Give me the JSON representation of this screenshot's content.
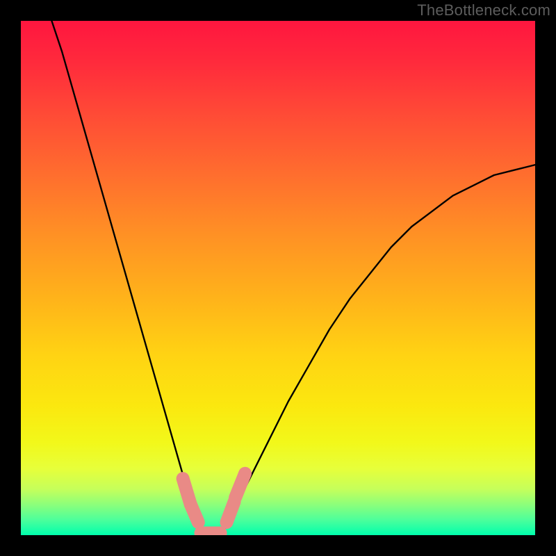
{
  "watermark": "TheBottleneck.com",
  "chart_data": {
    "type": "line",
    "title": "",
    "xlabel": "",
    "ylabel": "",
    "xlim": [
      0,
      100
    ],
    "ylim": [
      0,
      100
    ],
    "grid": false,
    "legend": false,
    "curve": {
      "comment": "V-shaped bottleneck curve; y is bottleneck percent (0 at trough)",
      "x": [
        6,
        8,
        10,
        12,
        14,
        16,
        18,
        20,
        22,
        24,
        26,
        28,
        30,
        32,
        34,
        35,
        37,
        39,
        41,
        44,
        48,
        52,
        56,
        60,
        64,
        68,
        72,
        76,
        80,
        84,
        88,
        92,
        96,
        100
      ],
      "y": [
        100,
        94,
        87,
        80,
        73,
        66,
        59,
        52,
        45,
        38,
        31,
        24,
        17,
        10,
        4,
        0,
        0,
        0,
        4,
        10,
        18,
        26,
        33,
        40,
        46,
        51,
        56,
        60,
        63,
        66,
        68,
        70,
        71,
        72
      ]
    },
    "markers": {
      "comment": "pink rounded-line markers near trough",
      "color": "#e98a86",
      "segments": [
        {
          "x1": 31.5,
          "y1": 11,
          "x2": 33.0,
          "y2": 6
        },
        {
          "x1": 33.0,
          "y1": 6,
          "x2": 34.5,
          "y2": 2.5
        },
        {
          "x1": 35.0,
          "y1": 0.4,
          "x2": 38.8,
          "y2": 0.4
        },
        {
          "x1": 40.0,
          "y1": 2.5,
          "x2": 41.5,
          "y2": 6.5
        },
        {
          "x1": 41.7,
          "y1": 7.3,
          "x2": 43.6,
          "y2": 12
        }
      ]
    },
    "background_gradient": {
      "top": "#ff163f",
      "mid": "#ffd313",
      "bottom": "#00ffad"
    }
  }
}
